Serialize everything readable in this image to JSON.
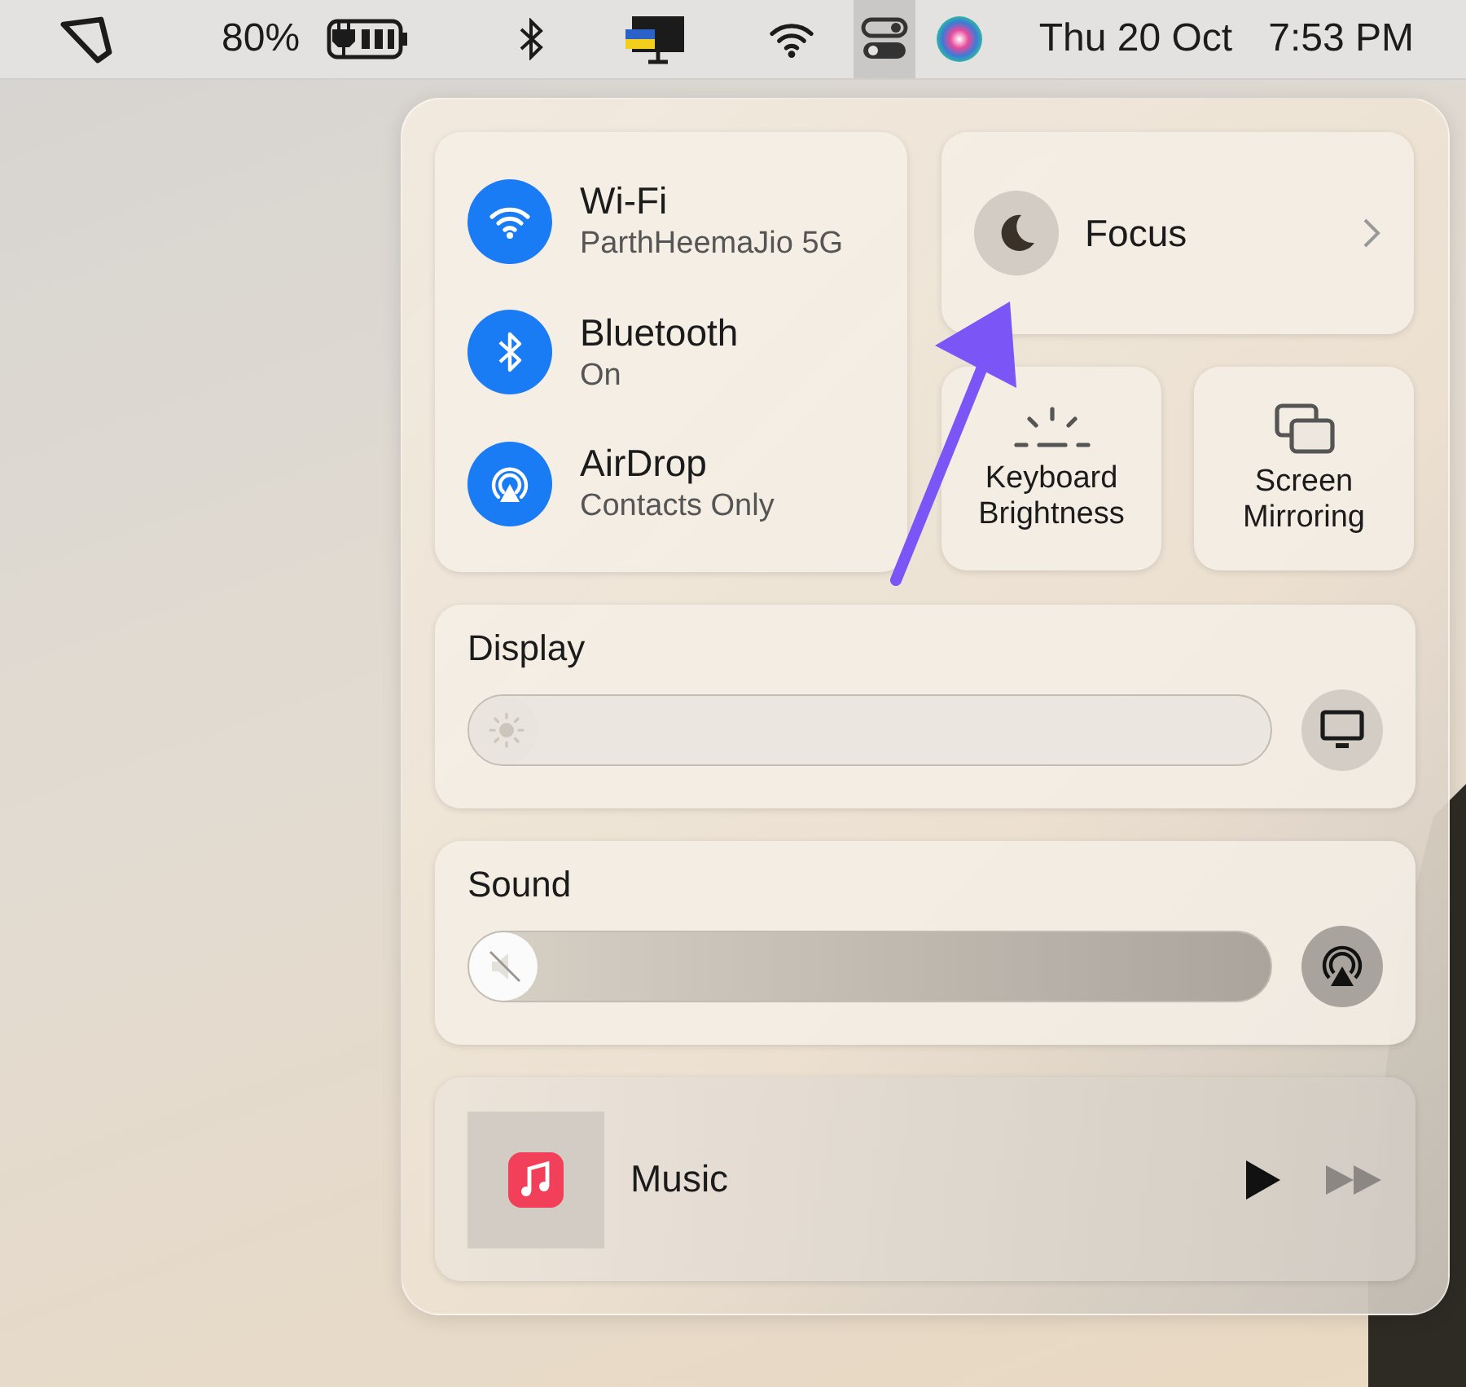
{
  "menu_bar": {
    "battery": "80%",
    "charging": true,
    "control_center": {
      "selected": true
    },
    "date": "Thu 20 Oct",
    "time": "7:53 PM"
  },
  "connectivity": [
    {
      "kind": "wifi",
      "name": "Wi-Fi",
      "status": "ParthHeemaJio 5G",
      "on": true
    },
    {
      "kind": "bluetooth",
      "name": "Bluetooth",
      "status": "On",
      "on": true
    },
    {
      "kind": "airdrop",
      "name": "AirDrop",
      "status": "Contacts Only",
      "on": true
    }
  ],
  "focus": {
    "label": "Focus",
    "on": false
  },
  "tiles": [
    {
      "kind": "keyboard",
      "label": "Keyboard Brightness"
    },
    {
      "kind": "mirroring",
      "label": "Screen Mirroring"
    }
  ],
  "sliders": [
    {
      "kind": "brightness",
      "title": "Display",
      "level": 0
    },
    {
      "kind": "volume",
      "title": "Sound",
      "level": 0
    }
  ],
  "now_playing": {
    "app": "Music"
  }
}
